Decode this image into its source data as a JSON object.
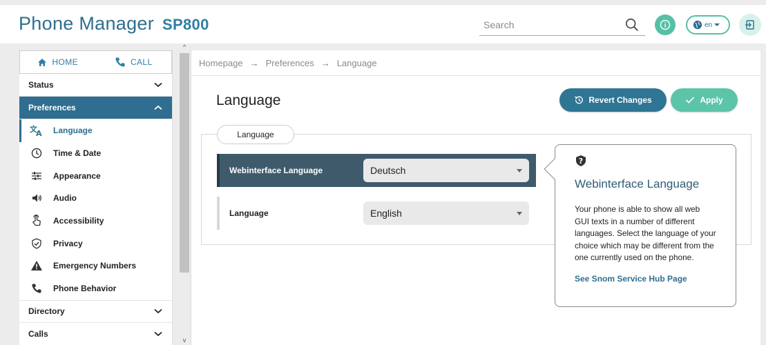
{
  "header": {
    "brand": "Phone Manager",
    "model": "SP800",
    "search_placeholder": "Search",
    "lang_label": "en"
  },
  "quicknav": {
    "home": "HOME",
    "call": "CALL"
  },
  "sidebar": {
    "sections": {
      "status": "Status",
      "preferences": "Preferences",
      "directory": "Directory",
      "calls": "Calls"
    },
    "items": [
      {
        "label": "Language",
        "icon": "translate-icon"
      },
      {
        "label": "Time & Date",
        "icon": "clock-icon"
      },
      {
        "label": "Appearance",
        "icon": "sliders-icon"
      },
      {
        "label": "Audio",
        "icon": "speaker-icon"
      },
      {
        "label": "Accessibility",
        "icon": "touch-icon"
      },
      {
        "label": "Privacy",
        "icon": "shield-icon"
      },
      {
        "label": "Emergency Numbers",
        "icon": "warning-icon"
      },
      {
        "label": "Phone Behavior",
        "icon": "phone-icon"
      }
    ]
  },
  "breadcrumb": [
    "Homepage",
    "Preferences",
    "Language"
  ],
  "breadcrumb_sep": "→",
  "main": {
    "title": "Language",
    "revert_label": "Revert Changes",
    "apply_label": "Apply",
    "panel_tab": "Language",
    "rows": [
      {
        "label": "Webinterface Language",
        "value": "Deutsch"
      },
      {
        "label": "Language",
        "value": "English"
      }
    ]
  },
  "tooltip": {
    "title": "Webinterface Language",
    "text": "Your phone is able to show all web GUI texts in a number of different languages. Select the language of your choice which may be different from the one currently used on the phone.",
    "link": "See Snom Service Hub Page"
  },
  "colors": {
    "primary": "#2f6e90",
    "accent": "#5cc4a8",
    "row_selected": "#3f5b6b"
  }
}
